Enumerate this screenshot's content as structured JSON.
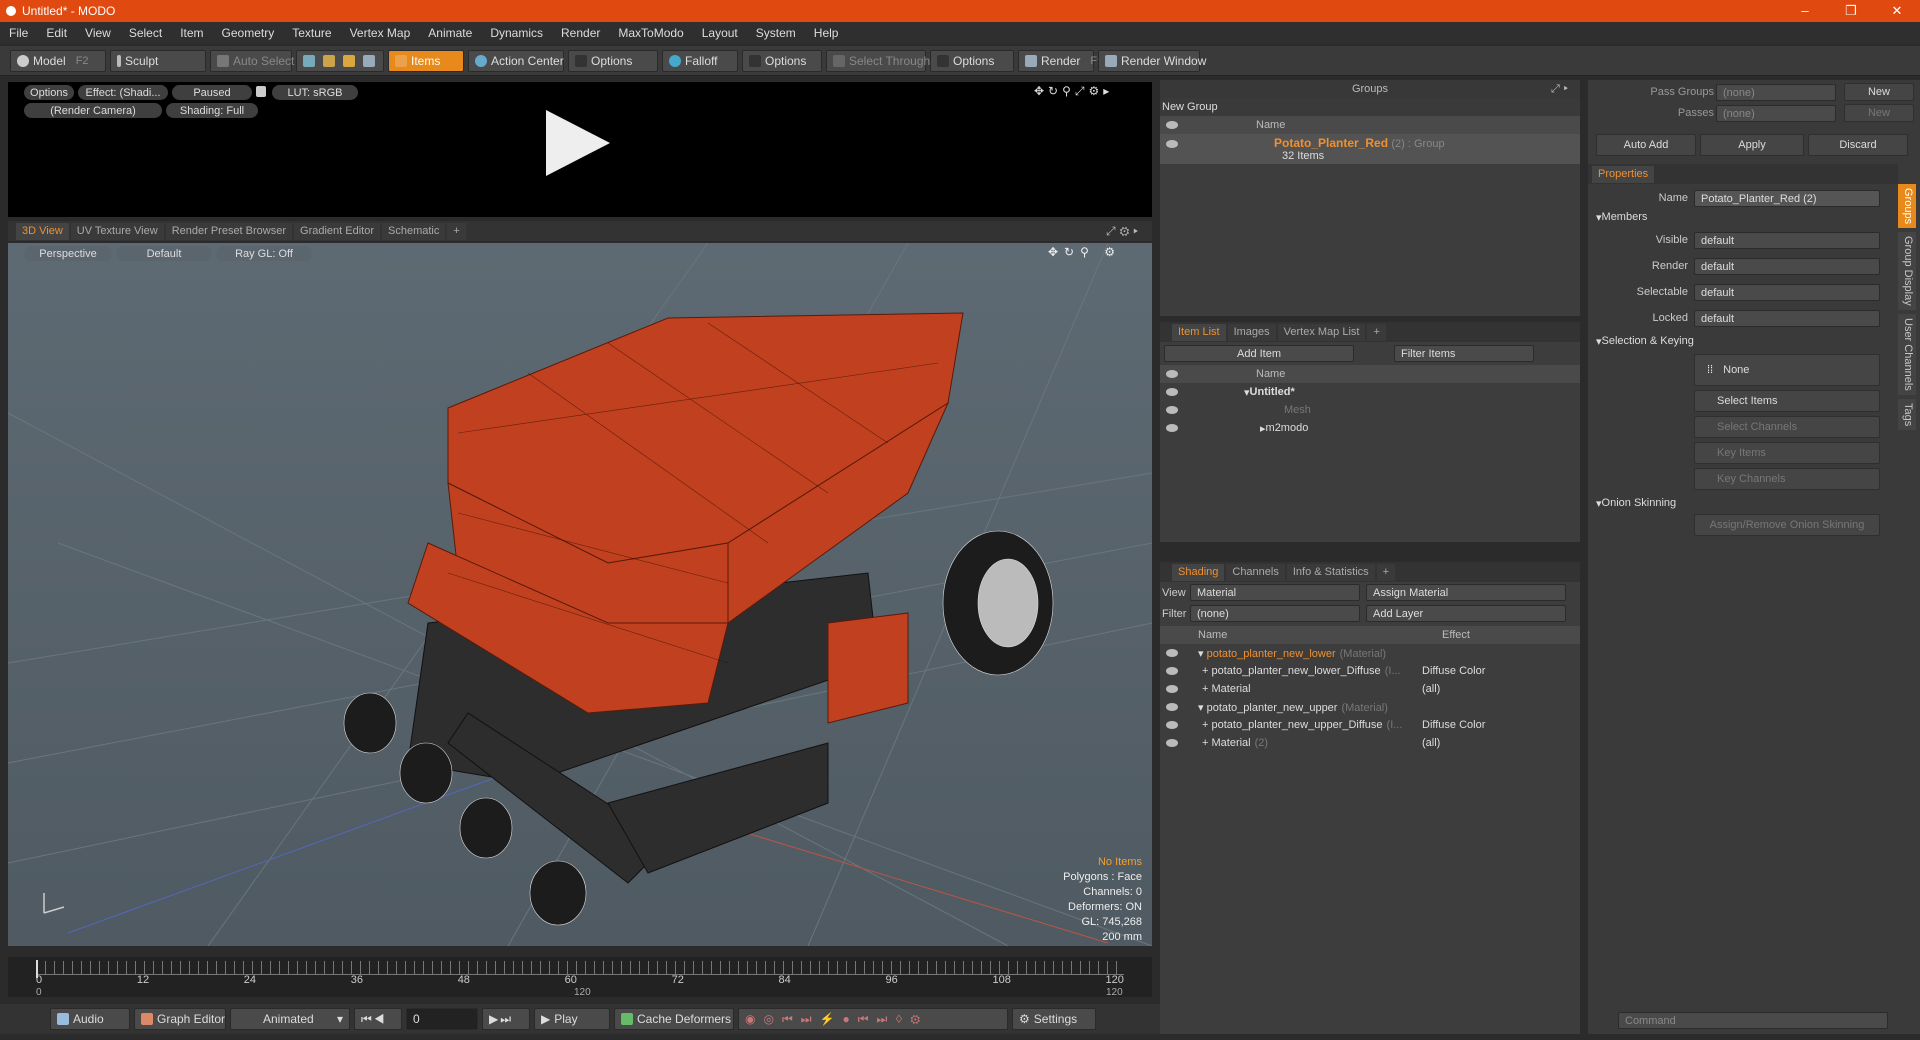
{
  "app": {
    "title": "Untitled* - MODO",
    "win_min": "–",
    "win_max": "❐",
    "win_close": "✕"
  },
  "menu": [
    "File",
    "Edit",
    "View",
    "Select",
    "Item",
    "Geometry",
    "Texture",
    "Vertex Map",
    "Animate",
    "Dynamics",
    "Render",
    "MaxToModo",
    "Layout",
    "System",
    "Help"
  ],
  "toolbar": {
    "model": "Model",
    "model_key": "F2",
    "sculpt": "Sculpt",
    "auto_select": "Auto Select",
    "items": "Items",
    "action_center": "Action Center",
    "options1": "Options",
    "falloff": "Falloff",
    "options2": "Options",
    "select_through": "Select Through",
    "options3": "Options",
    "render": "Render",
    "render_key": "F9",
    "render_window": "Render Window"
  },
  "preview": {
    "options": "Options",
    "effect": "Effect: (Shadi...",
    "paused": "Paused",
    "lut": "LUT: sRGB",
    "camera": "(Render Camera)",
    "shading": "Shading: Full"
  },
  "view_tabs": [
    "3D View",
    "UV Texture View",
    "Render Preset Browser",
    "Gradient Editor",
    "Schematic",
    "+"
  ],
  "viewport": {
    "perspective": "Perspective",
    "default": "Default",
    "raygl": "Ray GL: Off",
    "info": {
      "no_items": "No Items",
      "polygons": "Polygons : Face",
      "channels": "Channels: 0",
      "deformers": "Deformers: ON",
      "gl": "GL: 745,268",
      "size": "200 mm"
    }
  },
  "timeline": {
    "ticks": [
      "0",
      "12",
      "24",
      "36",
      "48",
      "60",
      "72",
      "84",
      "96",
      "108",
      "120"
    ],
    "sub_ticks": [
      "0",
      "120",
      "120"
    ]
  },
  "bottom": {
    "audio": "Audio",
    "graph_editor": "Graph Editor",
    "animated": "Animated",
    "frame": "0",
    "play": "Play",
    "cache_deformers": "Cache Deformers",
    "settings": "Settings"
  },
  "groups": {
    "title": "Groups",
    "new_group": "New Group",
    "col_name": "Name",
    "group_name": "Potato_Planter_Red",
    "group_suffix": "(2) : Group",
    "group_items": "32 Items"
  },
  "item_list": {
    "tabs": [
      "Item List",
      "Images",
      "Vertex Map List",
      "+"
    ],
    "add_item": "Add Item",
    "filter_items": "Filter Items",
    "col_name": "Name",
    "items": [
      "Untitled*",
      "Mesh",
      "m2modo"
    ]
  },
  "shading": {
    "tabs": [
      "Shading",
      "Channels",
      "Info & Statistics",
      "+"
    ],
    "view_label": "View",
    "view_value": "Material",
    "assign_material": "Assign Material",
    "filter_label": "Filter",
    "filter_value": "(none)",
    "add_layer": "Add Layer",
    "col_name": "Name",
    "col_effect": "Effect",
    "rows": [
      {
        "name": "potato_planter_new_lower",
        "suffix": "(Material)",
        "effect": "",
        "indent": 1,
        "orange": true
      },
      {
        "name": "potato_planter_new_lower_Diffuse",
        "suffix": "(I...",
        "effect": "Diffuse Color",
        "indent": 2,
        "orange": false
      },
      {
        "name": "Material",
        "suffix": "",
        "effect": "(all)",
        "indent": 2,
        "orange": false
      },
      {
        "name": "potato_planter_new_upper",
        "suffix": "(Material)",
        "effect": "",
        "indent": 1,
        "orange": false
      },
      {
        "name": "potato_planter_new_upper_Diffuse",
        "suffix": "(I...",
        "effect": "Diffuse Color",
        "indent": 2,
        "orange": false
      },
      {
        "name": "Material",
        "suffix": "(2)",
        "effect": "(all)",
        "indent": 2,
        "orange": false
      }
    ]
  },
  "right": {
    "pass_groups_label": "Pass Groups",
    "pass_groups_value": "(none)",
    "new1": "New",
    "passes_label": "Passes",
    "passes_value": "(none)",
    "new2": "New",
    "auto_add": "Auto Add",
    "apply": "Apply",
    "discard": "Discard",
    "properties_tab": "Properties",
    "name_label": "Name",
    "name_value": "Potato_Planter_Red (2)",
    "members": "Members",
    "visible_label": "Visible",
    "render_label": "Render",
    "selectable_label": "Selectable",
    "locked_label": "Locked",
    "default": "default",
    "selection_keying": "Selection & Keying",
    "none": "None",
    "select_items": "Select Items",
    "select_channels": "Select Channels",
    "key_items": "Key Items",
    "key_channels": "Key Channels",
    "onion_skinning": "Onion Skinning",
    "assign_onion": "Assign/Remove Onion Skinning",
    "side_tabs": [
      "Groups",
      "Group Display",
      "User Channels",
      "Tags"
    ],
    "command": "Command"
  },
  "colors": {
    "accent": "#e04a11",
    "orange": "#e8891c",
    "machine": "#c0401f"
  }
}
